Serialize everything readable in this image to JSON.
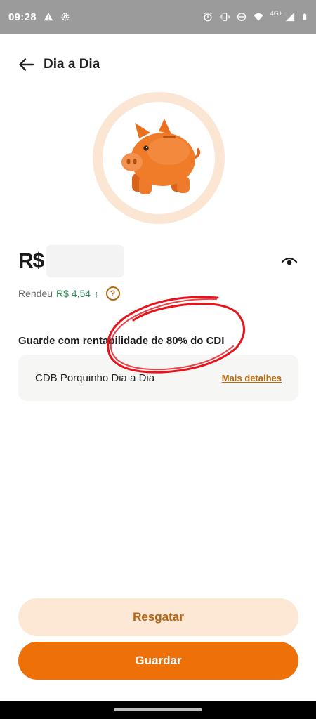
{
  "status_bar": {
    "time": "09:28",
    "network_label": "4G+",
    "icons_left": [
      "warning-icon",
      "settings-icon"
    ],
    "icons_right": [
      "alarm-icon",
      "vibrate-icon",
      "dnd-icon",
      "wifi-icon",
      "signal-icon",
      "battery-icon"
    ]
  },
  "header": {
    "title": "Dia a Dia",
    "back_icon": "arrow-left-icon"
  },
  "hero": {
    "illustration": "piggy-bank-icon",
    "ring_color": "#fbe6d4",
    "pig_color": "#f07c2a"
  },
  "balance": {
    "currency": "R$",
    "value_hidden": true,
    "visibility_icon": "eye-icon"
  },
  "yield": {
    "label": "Rendeu",
    "value": "R$ 4,54",
    "trend_arrow": "↑",
    "help_label": "?"
  },
  "investment": {
    "section_title": "Guarde com rentabilidade de 80% do CDI",
    "product_name": "CDB Porquinho Dia a Dia",
    "details_link": "Mais detalhes"
  },
  "actions": {
    "secondary_label": "Resgatar",
    "primary_label": "Guardar"
  },
  "colors": {
    "accent": "#ee7008",
    "accent_soft": "#fde8d6",
    "link": "#b86a10",
    "positive": "#2e8b57",
    "annotation": "#e8121a"
  }
}
